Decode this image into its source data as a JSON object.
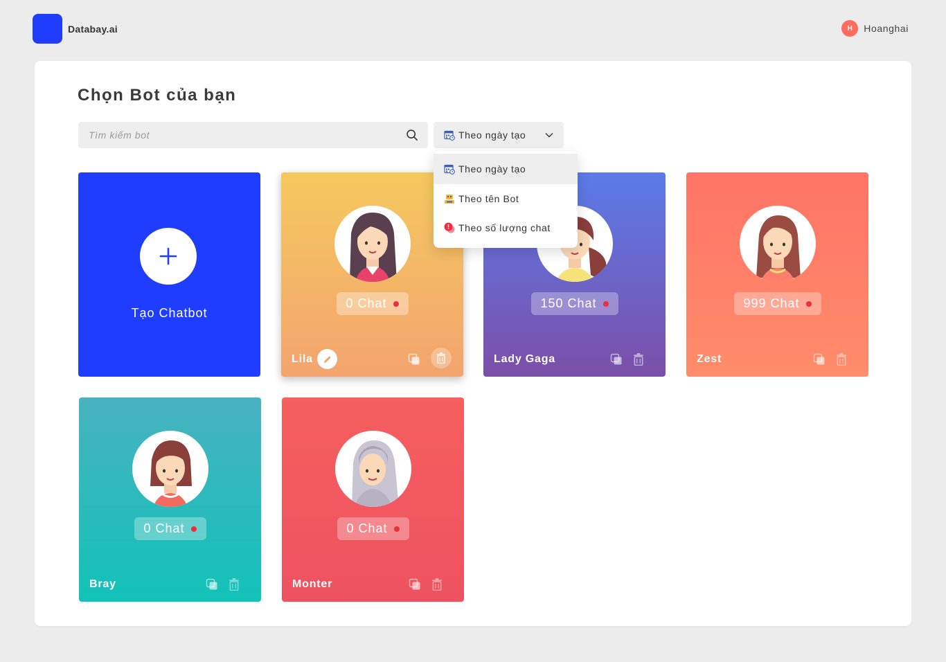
{
  "brand": {
    "name": "Databay.ai",
    "color": "#1f3dff"
  },
  "user": {
    "initial": "H",
    "name": "Hoanghai"
  },
  "page": {
    "title": "Chọn Bot của bạn"
  },
  "search": {
    "placeholder": "Tìm kiếm bot",
    "icon": "search-icon"
  },
  "sort": {
    "selected": "Theo ngày tạo",
    "options": [
      {
        "label": "Theo ngày tạo",
        "icon": "calendar-icon"
      },
      {
        "label": "Theo tên Bot",
        "icon": "bot-icon"
      },
      {
        "label": "Theo số lượng chat",
        "icon": "chat-bubble-icon"
      }
    ]
  },
  "create": {
    "label": "Tạo Chatbot"
  },
  "bots": [
    {
      "name": "Lila",
      "chat_label": "0 Chat",
      "gradient": [
        "#f5c95e",
        "#f3a46f"
      ],
      "pill": "rgba(255,255,255,0.35)"
    },
    {
      "name": "Lady Gaga",
      "chat_label": "150 Chat",
      "gradient": [
        "#5b7be8",
        "#7b4fa8"
      ],
      "pill": "rgba(255,255,255,0.30)"
    },
    {
      "name": "Zest",
      "chat_label": "999 Chat",
      "gradient": [
        "#ff7466",
        "#ff8c6a"
      ],
      "pill": "rgba(255,255,255,0.30)"
    },
    {
      "name": "Bray",
      "chat_label": "0 Chat",
      "gradient": [
        "#48b2c0",
        "#12c2b8"
      ],
      "pill": "rgba(255,255,255,0.30)"
    },
    {
      "name": "Monter",
      "chat_label": "0 Chat",
      "gradient": [
        "#f55f5f",
        "#ee5260"
      ],
      "pill": "rgba(255,255,255,0.30)"
    }
  ]
}
